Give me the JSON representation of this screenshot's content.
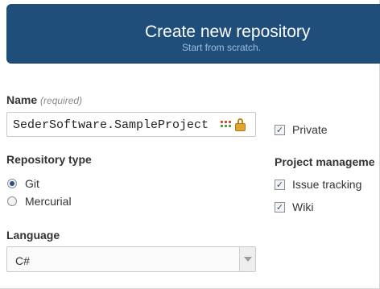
{
  "header": {
    "title": "Create new repository",
    "subtitle": "Start from scratch."
  },
  "name_field": {
    "label": "Name",
    "required_note": "(required)",
    "value": "SederSoftware.SampleProject"
  },
  "repository_type": {
    "label": "Repository type",
    "options": [
      {
        "label": "Git",
        "selected": true
      },
      {
        "label": "Mercurial",
        "selected": false
      }
    ]
  },
  "language": {
    "label": "Language",
    "selected": "C#"
  },
  "private": {
    "label": "Private",
    "checked": true
  },
  "project_management": {
    "label": "Project manageme",
    "options": [
      {
        "label": "Issue tracking",
        "checked": true
      },
      {
        "label": "Wiki",
        "checked": true
      }
    ]
  },
  "icons": {
    "field_icons": [
      "dots-icon",
      "lock-icon"
    ],
    "select_arrow": "chevron-down-icon"
  },
  "colors": {
    "header_bg": "#1f4e7b",
    "header_text": "#ffffff",
    "header_subtext": "#9fbedb",
    "lock": "#e0a52a"
  }
}
